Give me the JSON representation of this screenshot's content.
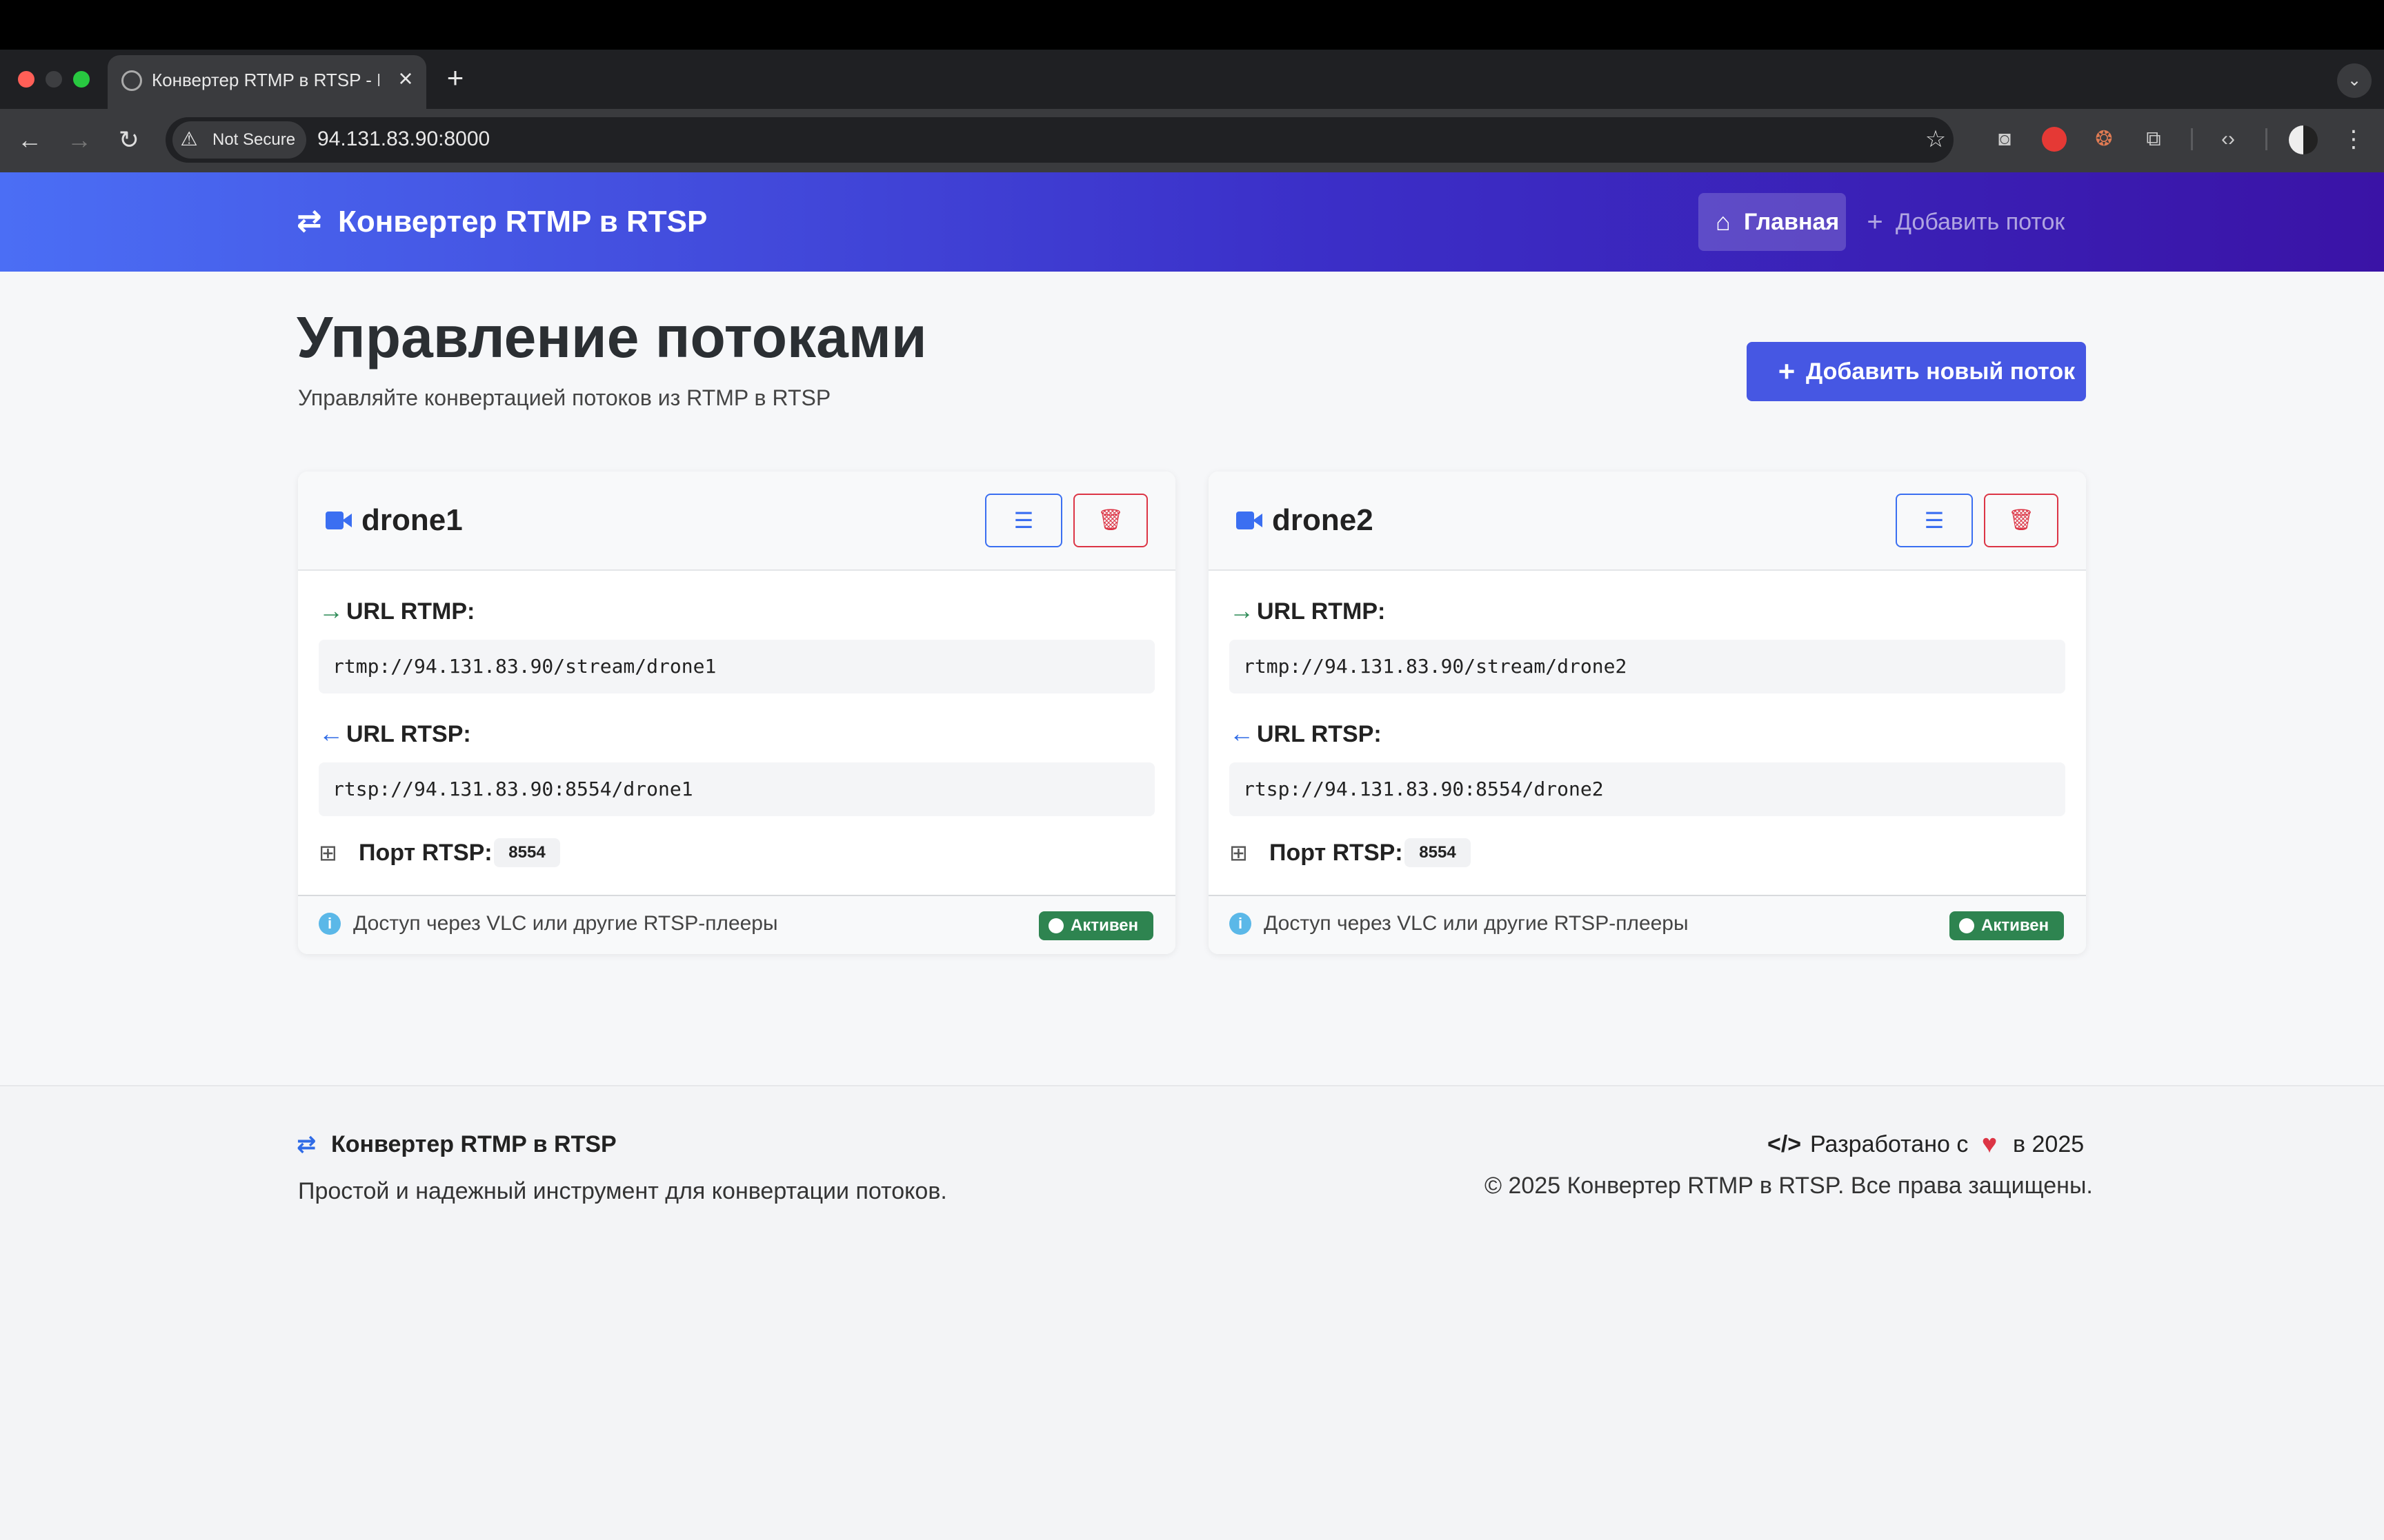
{
  "browser": {
    "tab_title": "Конвертер RTMP в RTSP - Г",
    "security_label": "Not Secure",
    "url": "94.131.83.90:8000"
  },
  "header": {
    "brand": "Конвертер RTMP в RTSP",
    "nav": [
      {
        "label": "Главная",
        "icon": "home-icon",
        "active": true
      },
      {
        "label": "Добавить поток",
        "icon": "plus-icon",
        "active": false
      }
    ]
  },
  "page": {
    "title": "Управление потоками",
    "subtitle": "Управляйте конвертацией потоков из RTMP в RTSP",
    "add_button": "Добавить новый поток"
  },
  "labels": {
    "rtmp_url": "URL RTMP:",
    "rtsp_url": "URL RTSP:",
    "rtsp_port": "Порт RTSP:",
    "access_hint": "Доступ через VLC или другие RTSP-плееры"
  },
  "streams": [
    {
      "name": "drone1",
      "rtmp_url": "rtmp://94.131.83.90/stream/drone1",
      "rtsp_url": "rtsp://94.131.83.90:8554/drone1",
      "rtsp_port": "8554",
      "status": "Активен"
    },
    {
      "name": "drone2",
      "rtmp_url": "rtmp://94.131.83.90/stream/drone2",
      "rtsp_url": "rtsp://94.131.83.90:8554/drone2",
      "rtsp_port": "8554",
      "status": "Активен"
    }
  ],
  "footer": {
    "brand": "Конвертер RTMP в RTSP",
    "description": "Простой и надежный инструмент для конвертации потоков.",
    "developed_prefix": "Разработано с",
    "developed_suffix": "в 2025",
    "copyright": "© 2025 Конвертер RTMP в RTSP. Все права защищены."
  },
  "colors": {
    "primary": "#4657e3",
    "accent_blue": "#3b6ff1",
    "danger": "#dc3545",
    "success": "#2e8450",
    "header_gradient_start": "#4b6ef5",
    "header_gradient_end": "#3a13a6"
  }
}
